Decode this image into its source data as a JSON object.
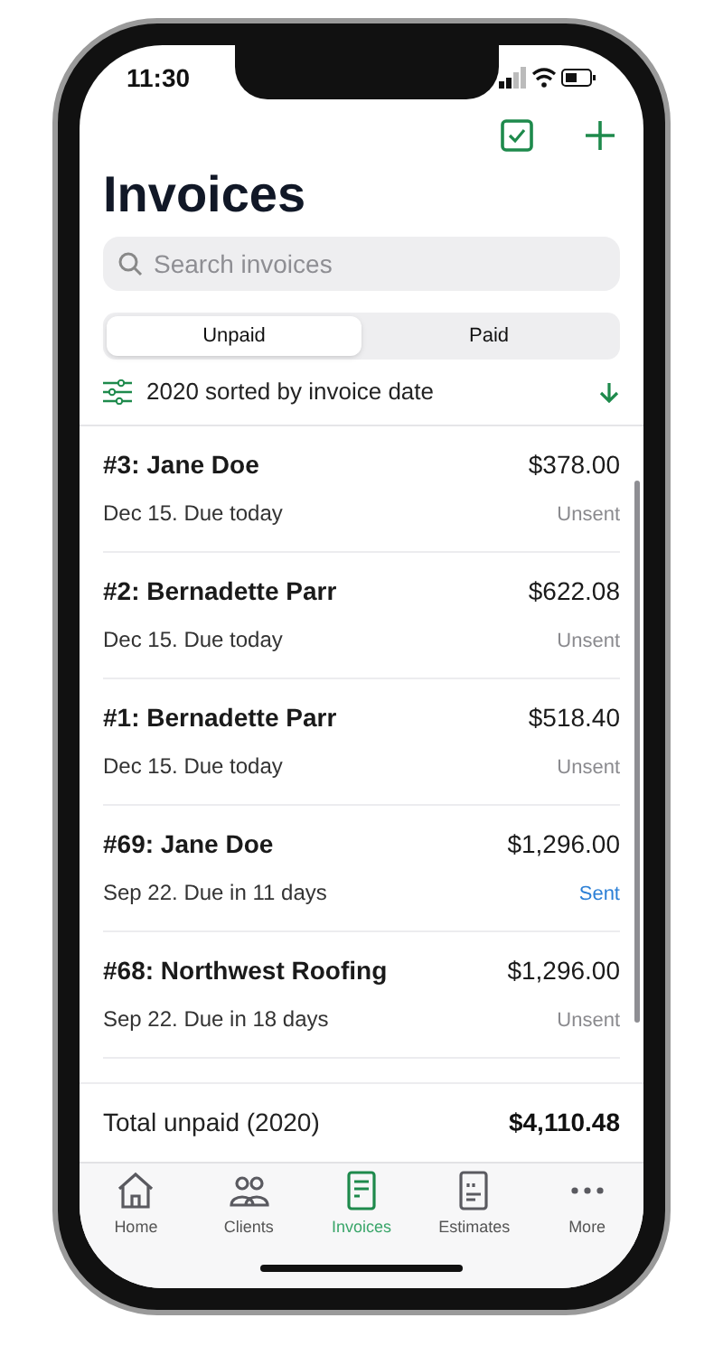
{
  "status_bar": {
    "time": "11:30"
  },
  "title": "Invoices",
  "search": {
    "placeholder": "Search invoices"
  },
  "segments": [
    {
      "label": "Unpaid",
      "selected": true
    },
    {
      "label": "Paid",
      "selected": false
    }
  ],
  "sort_label": "2020 sorted by invoice date",
  "invoices": [
    {
      "title": "#3: Jane Doe",
      "amount": "$378.00",
      "due": "Dec 15. Due today",
      "status": "Unsent",
      "sent": false
    },
    {
      "title": "#2: Bernadette Parr",
      "amount": "$622.08",
      "due": "Dec 15. Due today",
      "status": "Unsent",
      "sent": false
    },
    {
      "title": "#1: Bernadette Parr",
      "amount": "$518.40",
      "due": "Dec 15. Due today",
      "status": "Unsent",
      "sent": false
    },
    {
      "title": "#69: Jane Doe",
      "amount": "$1,296.00",
      "due": "Sep 22. Due in 11 days",
      "status": "Sent",
      "sent": true
    },
    {
      "title": "#68: Northwest Roofing",
      "amount": "$1,296.00",
      "due": "Sep 22. Due in 18 days",
      "status": "Unsent",
      "sent": false
    }
  ],
  "total": {
    "label": "Total unpaid (2020)",
    "amount": "$4,110.48"
  },
  "tab_bar": [
    {
      "label": "Home",
      "kind": "home",
      "selected": false
    },
    {
      "label": "Clients",
      "kind": "clients",
      "selected": false
    },
    {
      "label": "Invoices",
      "kind": "invoices",
      "selected": true
    },
    {
      "label": "Estimates",
      "kind": "estimates",
      "selected": false
    },
    {
      "label": "More",
      "kind": "more",
      "selected": false
    }
  ]
}
